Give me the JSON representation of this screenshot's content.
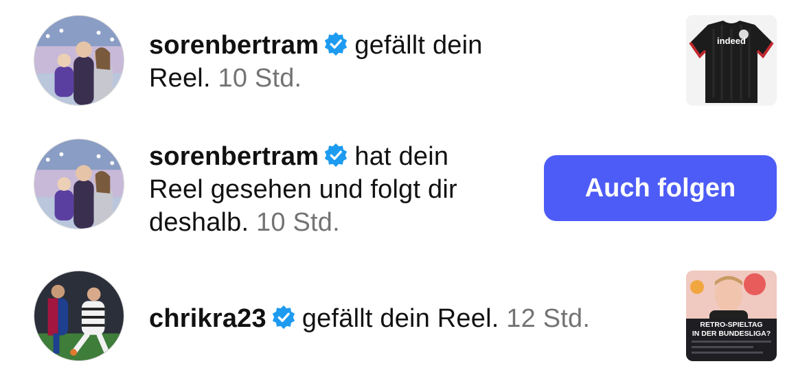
{
  "colors": {
    "button": "#4d5cf6",
    "verified": "#1d9bf0",
    "time": "#737373"
  },
  "notifications": [
    {
      "username": "sorenbertram",
      "action_line1": "gefällt dein",
      "action_line2": "Reel.",
      "time": "10 Std.",
      "avatar_icon": "avatar-couple-stadium",
      "thumbnail_icon": "black-jersey-thumbnail",
      "thumbnail_text": "indeed"
    },
    {
      "username": "sorenbertram",
      "action_line1": "hat dein",
      "action_line2": "Reel gesehen und folgt dir",
      "action_line3": "deshalb.",
      "time": "10 Std.",
      "avatar_icon": "avatar-couple-stadium",
      "button_label": "Auch folgen"
    },
    {
      "username": "chrikra23",
      "action": "gefällt dein Reel.",
      "time": "12 Std.",
      "avatar_icon": "avatar-football-players",
      "thumbnail_icon": "retro-spieltag-thumbnail",
      "thumbnail_text_line1": "RETRO-SPIELTAG",
      "thumbnail_text_line2": "IN DER BUNDESLIGA?"
    }
  ]
}
